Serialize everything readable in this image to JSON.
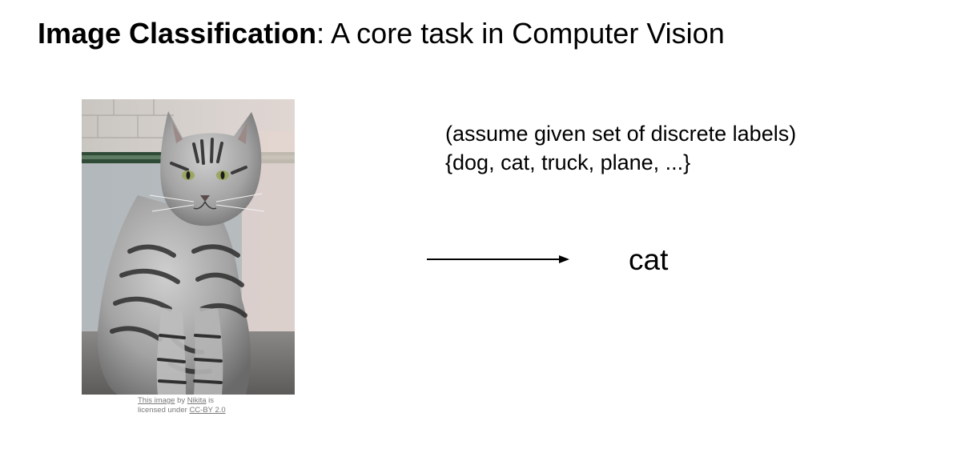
{
  "title": {
    "bold": "Image Classification",
    "rest": ": A core task in Computer Vision"
  },
  "image": {
    "subject": "tabby cat photograph",
    "credit": {
      "link1": "This image",
      "by": " by ",
      "author": "Nikita",
      "is": " is",
      "licensed": "licensed under ",
      "license": "CC-BY 2.0"
    }
  },
  "labels": {
    "line1": "(assume given set of discrete labels)",
    "line2": "{dog, cat, truck, plane, ...}"
  },
  "arrow_icon": "right-arrow",
  "prediction": "cat"
}
